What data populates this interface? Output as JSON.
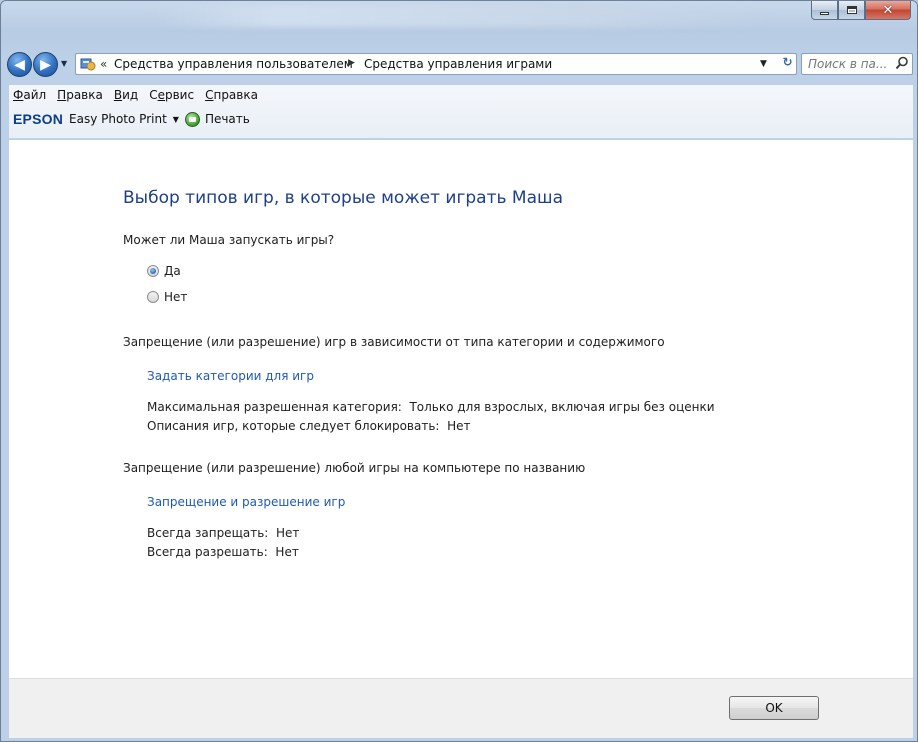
{
  "window": {
    "caption_buttons": {
      "minimize_icon": "minimize-icon",
      "maximize_icon": "maximize-icon",
      "close_icon": "close-icon",
      "close_color": "#c2462f"
    }
  },
  "navigation": {
    "back_icon": "back-arrow-icon",
    "forward_icon": "forward-arrow-icon",
    "breadcrumb_overflow": "«",
    "breadcrumbs": [
      "Средства управления пользователем",
      "Средства управления играми"
    ],
    "search_placeholder": "Поиск в па...",
    "refresh_icon": "refresh-icon",
    "search_icon": "search-icon"
  },
  "menu": {
    "items": [
      {
        "hotkey": "Ф",
        "rest": "айл"
      },
      {
        "hotkey": "П",
        "rest": "равка"
      },
      {
        "hotkey": "В",
        "rest": "ид"
      },
      {
        "pre": "С",
        "hotkey": "е",
        "rest": "рвис"
      },
      {
        "hotkey": "С",
        "rest": "правка"
      }
    ]
  },
  "epson_toolbar": {
    "logo": "EPSON",
    "product": "Easy Photo Print",
    "print_label": "Печать",
    "logo_color": "#0a3d8f"
  },
  "content": {
    "title": "Выбор типов игр, в которые может играть Маша",
    "question": "Может ли Маша запускать игры?",
    "radio_yes": "Да",
    "radio_no": "Нет",
    "selected": "yes",
    "section_category": "Запрещение (или разрешение) игр в зависимости от типа категории и содержимого",
    "link_categories": "Задать категории для игр",
    "max_category_label": "Максимальная разрешенная категория:",
    "max_category_value": "Только для взрослых, включая игры без оценки",
    "block_desc_label": "Описания игр, которые следует блокировать:",
    "block_desc_value": "Нет",
    "section_name": "Запрещение (или разрешение) любой игры на компьютере по названию",
    "link_allow_block": "Запрещение и разрешение игр",
    "always_block_label": "Всегда запрещать:",
    "always_block_value": "Нет",
    "always_allow_label": "Всегда разрешать:",
    "always_allow_value": "Нет",
    "title_color": "#1e3f8a",
    "link_color": "#1f59b5"
  },
  "footer": {
    "ok_label": "OK"
  }
}
